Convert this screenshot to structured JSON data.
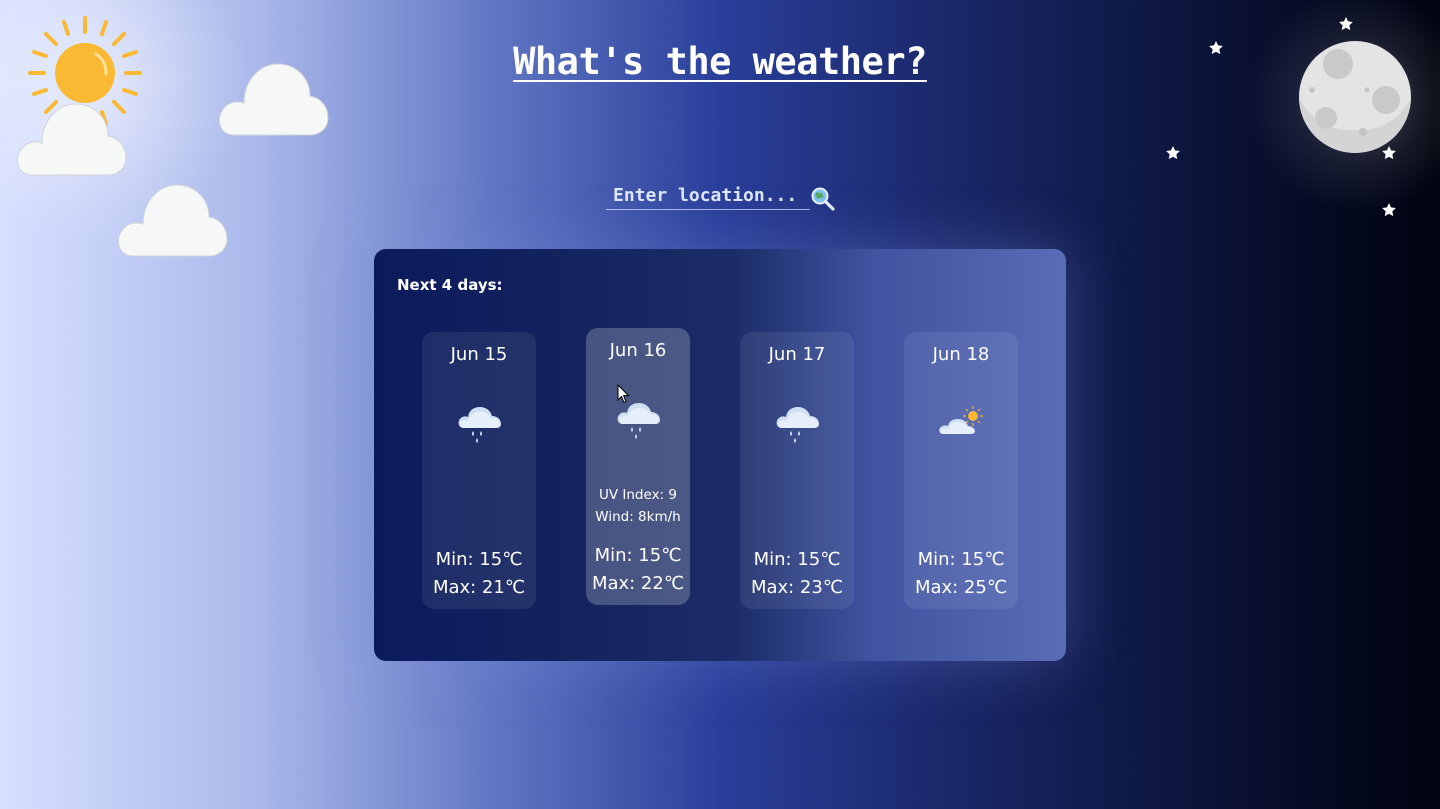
{
  "page": {
    "title": "What's the weather?"
  },
  "search": {
    "placeholder": "Enter location...",
    "value": ""
  },
  "forecast": {
    "heading": "Next 4 days:",
    "days": [
      {
        "date": "Jun 15",
        "icon": "rain-cloud-icon",
        "min": "Min: 15℃",
        "max": "Max: 21℃"
      },
      {
        "date": "Jun 16",
        "icon": "rain-cloud-icon",
        "uv": "UV Index: 9",
        "wind": "Wind: 8km/h",
        "min": "Min: 15℃",
        "max": "Max: 22℃"
      },
      {
        "date": "Jun 17",
        "icon": "rain-cloud-icon",
        "min": "Min: 15℃",
        "max": "Max: 23℃"
      },
      {
        "date": "Jun 18",
        "icon": "partly-cloudy-icon",
        "min": "Min: 15℃",
        "max": "Max: 25℃"
      }
    ]
  },
  "colors": {
    "sun": "#f9b933",
    "cloud": "#f6f7f7",
    "moon": "#e4e4e4",
    "text": "#ffffff"
  }
}
